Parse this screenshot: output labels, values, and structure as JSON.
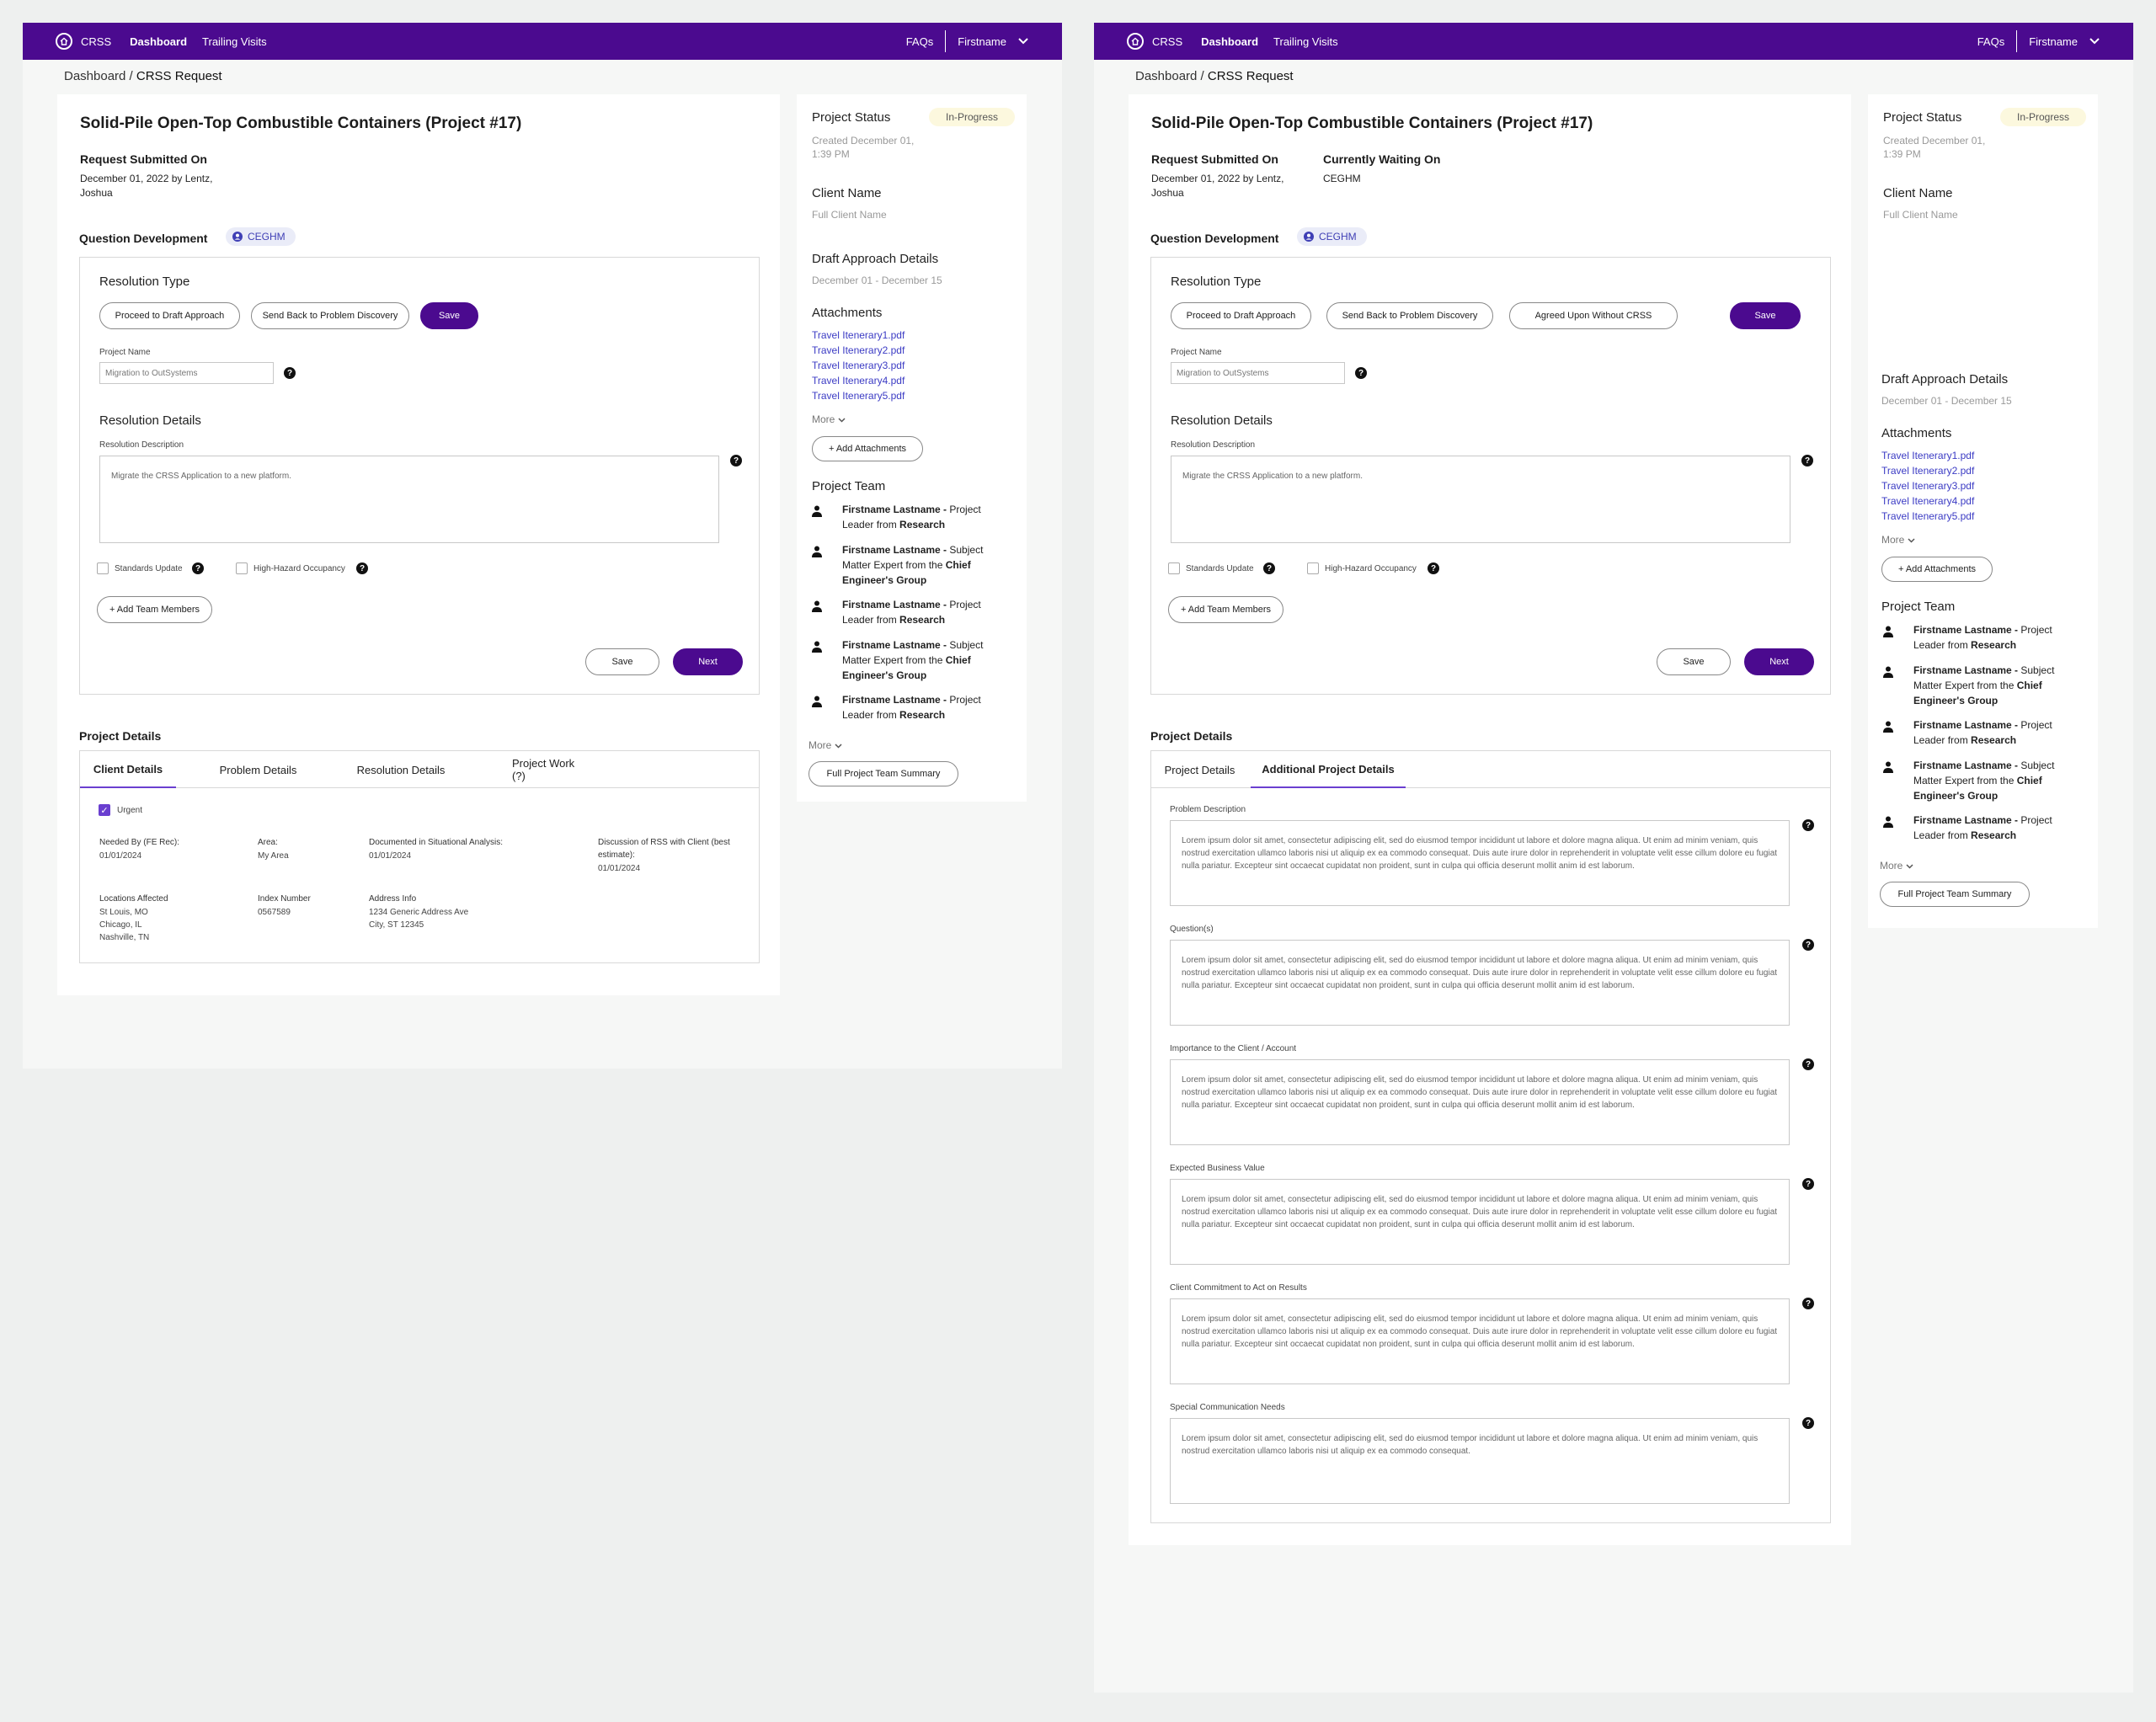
{
  "nav": {
    "brand": "CRSS",
    "dashboard": "Dashboard",
    "trailing": "Trailing Visits",
    "faqs": "FAQs",
    "user": "Firstname"
  },
  "breadcrumb": {
    "root": "Dashboard / ",
    "current": "CRSS Request"
  },
  "project": {
    "title": "Solid-Pile Open-Top Combustible Containers (Project #17)",
    "submitted_label": "Request Submitted On",
    "submitted_value": "December 01, 2022 by Lentz, Joshua",
    "waiting_label": "Currently Waiting On",
    "waiting_value": "CEGHM"
  },
  "qdev": {
    "label": "Question Development",
    "badge": "CEGHM"
  },
  "resolution": {
    "type_label": "Resolution Type",
    "btn_proceed": "Proceed to Draft Approach",
    "btn_send_back": "Send Back to Problem Discovery",
    "btn_agreed": "Agreed Upon Without CRSS",
    "btn_save": "Save",
    "project_name_label": "Project Name",
    "project_name_value": "Migration to OutSystems",
    "details_label": "Resolution Details",
    "desc_label": "Resolution Description",
    "desc_value": "Migrate the CRSS Application to a new platform.",
    "standards": "Standards Update",
    "hazard": "High-Hazard Occupancy",
    "add_team": "+ Add Team Members",
    "save": "Save",
    "next": "Next",
    "help": "?"
  },
  "details": {
    "heading": "Project Details",
    "tabs_left": [
      "Client Details",
      "Problem Details",
      "Resolution Details",
      "Project Work (?)"
    ],
    "tabs_right": [
      "Project Details",
      "Additional Project Details"
    ],
    "urgent": "Urgent",
    "needed_by_label": "Needed By (FE Rec):",
    "needed_by": "01/01/2024",
    "area_label": "Area:",
    "area": "My Area",
    "documented_label": "Documented in Situational Analysis:",
    "documented": "01/01/2024",
    "discussion_label": "Discussion of RSS with Client (best estimate):",
    "discussion": "01/01/2024",
    "locations_label": "Locations Affected",
    "locations": [
      "St Louis, MO",
      "Chicago, IL",
      "Nashville, TN"
    ],
    "index_label": "Index Number",
    "index": "0567589",
    "address_label": "Address Info",
    "address": [
      "1234 Generic Address Ave",
      "City, ST 12345"
    ]
  },
  "additional": {
    "fields": [
      {
        "label": "Problem Description",
        "text": "Lorem ipsum dolor sit amet, consectetur adipiscing elit, sed do eiusmod tempor incididunt ut labore et dolore magna aliqua. Ut enim ad minim veniam, quis nostrud exercitation ullamco laboris nisi ut aliquip ex ea commodo consequat. Duis aute irure dolor in reprehenderit in voluptate velit esse cillum dolore eu fugiat nulla pariatur. Excepteur sint occaecat cupidatat non proident, sunt in culpa qui officia deserunt mollit anim id est laborum."
      },
      {
        "label": "Question(s)",
        "text": "Lorem ipsum dolor sit amet, consectetur adipiscing elit, sed do eiusmod tempor incididunt ut labore et dolore magna aliqua. Ut enim ad minim veniam, quis nostrud exercitation ullamco laboris nisi ut aliquip ex ea commodo consequat. Duis aute irure dolor in reprehenderit in voluptate velit esse cillum dolore eu fugiat nulla pariatur. Excepteur sint occaecat cupidatat non proident, sunt in culpa qui officia deserunt mollit anim id est laborum."
      },
      {
        "label": "Importance to the Client / Account",
        "text": "Lorem ipsum dolor sit amet, consectetur adipiscing elit, sed do eiusmod tempor incididunt ut labore et dolore magna aliqua. Ut enim ad minim veniam, quis nostrud exercitation ullamco laboris nisi ut aliquip ex ea commodo consequat. Duis aute irure dolor in reprehenderit in voluptate velit esse cillum dolore eu fugiat nulla pariatur. Excepteur sint occaecat cupidatat non proident, sunt in culpa qui officia deserunt mollit anim id est laborum."
      },
      {
        "label": "Expected Business Value",
        "text": "Lorem ipsum dolor sit amet, consectetur adipiscing elit, sed do eiusmod tempor incididunt ut labore et dolore magna aliqua. Ut enim ad minim veniam, quis nostrud exercitation ullamco laboris nisi ut aliquip ex ea commodo consequat. Duis aute irure dolor in reprehenderit in voluptate velit esse cillum dolore eu fugiat nulla pariatur. Excepteur sint occaecat cupidatat non proident, sunt in culpa qui officia deserunt mollit anim id est laborum."
      },
      {
        "label": "Client Commitment to Act on Results",
        "text": "Lorem ipsum dolor sit amet, consectetur adipiscing elit, sed do eiusmod tempor incididunt ut labore et dolore magna aliqua. Ut enim ad minim veniam, quis nostrud exercitation ullamco laboris nisi ut aliquip ex ea commodo consequat. Duis aute irure dolor in reprehenderit in voluptate velit esse cillum dolore eu fugiat nulla pariatur. Excepteur sint occaecat cupidatat non proident, sunt in culpa qui officia deserunt mollit anim id est laborum."
      },
      {
        "label": "Special Communication Needs",
        "text": "Lorem ipsum dolor sit amet, consectetur adipiscing elit, sed do eiusmod tempor incididunt ut labore et dolore magna aliqua. Ut enim ad minim veniam, quis nostrud exercitation ullamco laboris nisi ut aliquip ex ea commodo consequat."
      }
    ]
  },
  "sidebar": {
    "status_label": "Project Status",
    "status": "In-Progress",
    "created": "Created December 01, 1:39 PM",
    "client_label": "Client Name",
    "client_value": "Full Client Name",
    "draft_label": "Draft Approach Details",
    "draft_dates": "December 01 - December 15",
    "attachments_label": "Attachments",
    "attachments": [
      "Travel Itenerary1.pdf",
      "Travel Itenerary2.pdf",
      "Travel Itenerary3.pdf",
      "Travel Itenerary4.pdf",
      "Travel Itenerary5.pdf"
    ],
    "more": "More",
    "add_attachments": "+ Add Attachments",
    "team_label": "Project Team",
    "team": [
      {
        "name": "Firstname Lastname -",
        "role": " Project Leader from ",
        "group": "Research"
      },
      {
        "name": "Firstname Lastname -",
        "role": " Subject Matter Expert from the ",
        "group": "Chief Engineer's Group"
      },
      {
        "name": "Firstname Lastname -",
        "role": " Project Leader from ",
        "group": "Research"
      },
      {
        "name": "Firstname Lastname -",
        "role": " Subject Matter Expert from the ",
        "group": "Chief Engineer's Group"
      },
      {
        "name": "Firstname Lastname -",
        "role": " Project Leader from ",
        "group": "Research"
      }
    ],
    "summary_button": "Full Project Team Summary"
  },
  "colors": {
    "brand": "#4b0a8f",
    "accent": "#6a3fd0",
    "link": "#3b3bc4",
    "status_bg": "#fcf8de"
  }
}
